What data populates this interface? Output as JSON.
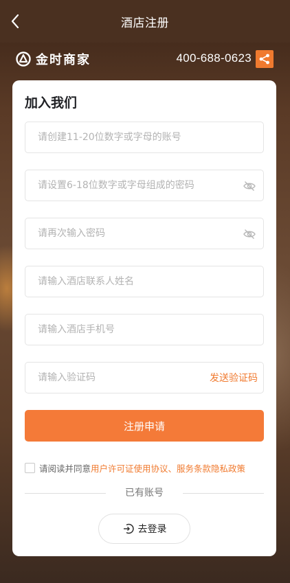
{
  "topbar": {
    "title": "酒店注册",
    "back_icon": "chevron-left-icon"
  },
  "brand": {
    "name": "金时商家",
    "hotline": "400-688-0623",
    "share_icon": "share-icon"
  },
  "colors": {
    "accent": "#f07a2f",
    "button": "#f47a38",
    "header": "#4a3020"
  },
  "form": {
    "title": "加入我们",
    "account_placeholder": "请创建11-20位数字或字母的账号",
    "password_placeholder": "请设置6-18位数字或字母组成的密码",
    "confirm_placeholder": "请再次输入密码",
    "contact_placeholder": "请输入酒店联系人姓名",
    "phone_placeholder": "请输入酒店手机号",
    "code_placeholder": "请输入验证码",
    "send_code_label": "发送验证码",
    "submit_label": "注册申请"
  },
  "agreement": {
    "prefix": "请阅读并同意",
    "link_text": "用户许可证使用协议、服务条款隐私政策"
  },
  "login": {
    "divider_text": "已有账号",
    "button_label": "去登录"
  }
}
